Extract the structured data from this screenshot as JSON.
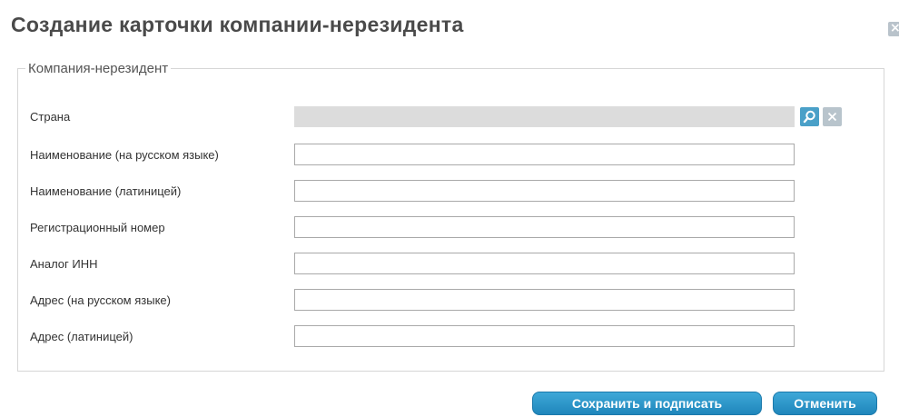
{
  "dialog": {
    "title": "Создание карточки компании-нерезидента",
    "close_icon": "close-icon"
  },
  "group": {
    "legend": "Компания-нерезидент",
    "fields": [
      {
        "label": "Страна",
        "value": "",
        "disabled": true
      },
      {
        "label": "Наименование (на русском языке)",
        "value": ""
      },
      {
        "label": "Наименование (латиницей)",
        "value": ""
      },
      {
        "label": "Регистрационный номер",
        "value": ""
      },
      {
        "label": "Аналог ИНН",
        "value": ""
      },
      {
        "label": "Адрес (на русском языке)",
        "value": ""
      },
      {
        "label": "Адрес (латиницей)",
        "value": ""
      }
    ],
    "country_actions": {
      "search_icon": "search-icon",
      "clear_icon": "clear-icon"
    }
  },
  "actions": {
    "save_label": "Сохранить и подписать",
    "cancel_label": "Отменить"
  },
  "colors": {
    "accent": "#2b96c9",
    "title": "#4a4a4a",
    "disabled_field": "#dcdcdc"
  }
}
